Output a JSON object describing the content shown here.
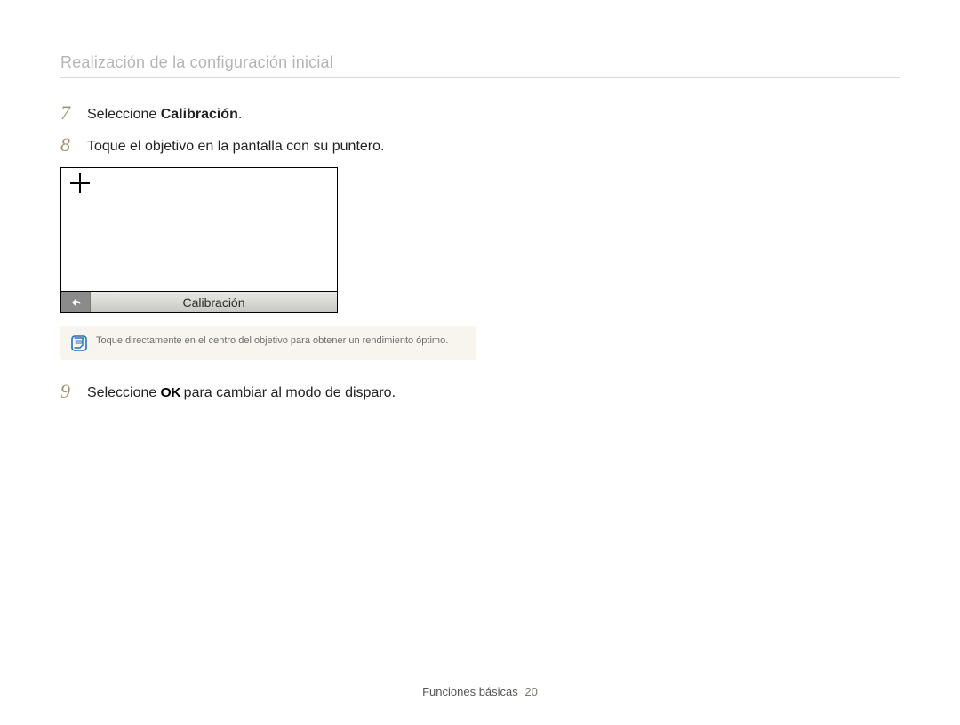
{
  "header": {
    "title": "Realización de la configuración inicial"
  },
  "steps": {
    "s7": {
      "num": "7",
      "pre": "Seleccione ",
      "bold": "Calibración",
      "post": "."
    },
    "s8": {
      "num": "8",
      "text": "Toque el objetivo en la pantalla con su puntero."
    },
    "s9": {
      "num": "9",
      "pre": "Seleccione ",
      "ok": "OK",
      "post": " para cambiar al modo de disparo."
    }
  },
  "figure": {
    "bar_label": "Calibración",
    "back_icon_name": "back-icon"
  },
  "note": {
    "text": "Toque directamente en el centro del objetivo para obtener un rendimiento óptimo."
  },
  "footer": {
    "section": "Funciones básicas",
    "page": "20"
  }
}
